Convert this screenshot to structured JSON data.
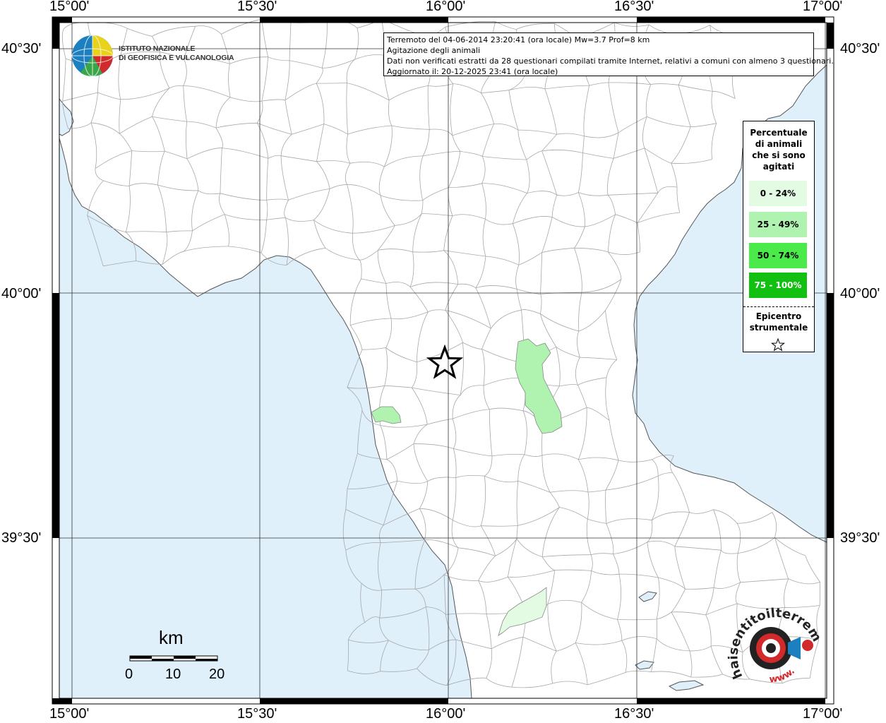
{
  "map": {
    "info": {
      "line1": "Terremoto del 04-06-2014 23:20:41 (ora locale) Mw=3.7 Prof=8 km",
      "line2": "Agitazione degli animali",
      "line3": "Dati non verificati estratti da 28 questionari compilati tramite Internet, relativi a comuni con almeno 3 questionari.",
      "line4": "Aggiornato il: 20-12-2025 23:41 (ora locale)"
    },
    "legend": {
      "title_lines": [
        "Percentuale",
        "di animali",
        "che si sono",
        "agitati"
      ],
      "classes": [
        {
          "label": "0 - 24%",
          "color": "#e2fbe2"
        },
        {
          "label": "25 - 49%",
          "color": "#b0f3b0"
        },
        {
          "label": "50 - 74%",
          "color": "#4bea4b"
        },
        {
          "label": "75 - 100%",
          "color": "#12c012"
        }
      ],
      "epicenter_lines": [
        "Epicentro",
        "strumentale"
      ]
    },
    "longitude_labels": [
      "15°00'",
      "15°30'",
      "16°00'",
      "16°30'",
      "17°00'"
    ],
    "latitude_labels": [
      "40°30'",
      "40°00'",
      "39°30'"
    ],
    "scale": {
      "title": "km",
      "ticks": [
        "0",
        "10",
        "20"
      ]
    },
    "logos": {
      "ingv_line1": "ISTITUTO NAZIONALE",
      "ingv_line2": "DI GEOFISICA E VULCANOLOGIA",
      "hst_text": "haisentitoilterremoto.it",
      "hst_text2": "www."
    },
    "colors": {
      "sea": "#dff0fb",
      "land": "#ffffff",
      "boundary": "#a8a8a8"
    }
  }
}
